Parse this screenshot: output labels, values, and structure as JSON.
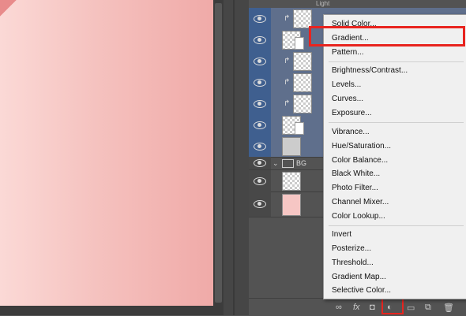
{
  "layers": {
    "top_label": "Light",
    "group_name": "BG"
  },
  "menu": {
    "items_group1": [
      "Solid Color...",
      "Gradient...",
      "Pattern..."
    ],
    "items_group2": [
      "Brightness/Contrast...",
      "Levels...",
      "Curves...",
      "Exposure..."
    ],
    "items_group3": [
      "Vibrance...",
      "Hue/Saturation...",
      "Color Balance...",
      "Black  White...",
      "Photo Filter...",
      "Channel Mixer...",
      "Color Lookup..."
    ],
    "items_group4": [
      "Invert",
      "Posterize...",
      "Threshold...",
      "Gradient Map...",
      "Selective Color..."
    ]
  },
  "bottom_bar": {
    "fx_label": "fx"
  },
  "colors": {
    "highlight": "#e8241f",
    "selected_layer": "#3f5f8f",
    "canvas_pink": "#f5c2bf"
  }
}
